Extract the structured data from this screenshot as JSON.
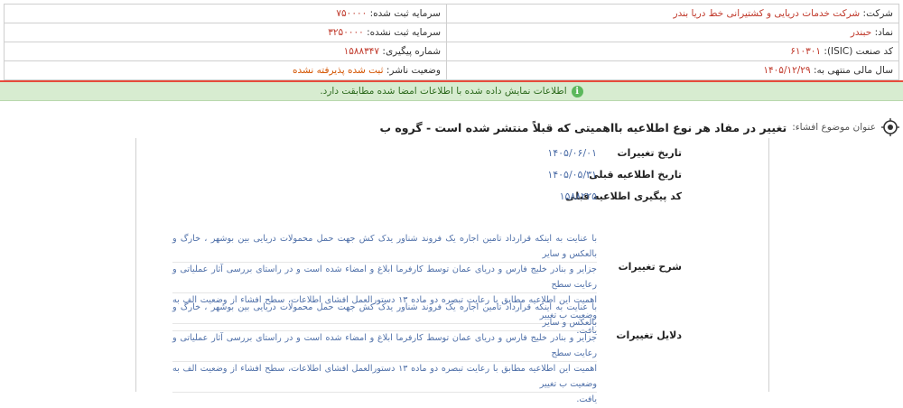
{
  "header": {
    "company_label": "شرکت:",
    "company_value": "شرکت خدمات دریایی و کشتیرانی خط دریا بندر",
    "symbol_label": "نماد:",
    "symbol_value": "حبندر",
    "isic_label": "کد صنعت (ISIC):",
    "isic_value": "۶۱۰۳۰۱",
    "fiscal_label": "سال مالی منتهی به:",
    "fiscal_value": "۱۴۰۵/۱۲/۲۹",
    "capital_registered_label": "سرمایه ثبت شده:",
    "capital_registered_value": "۷۵۰۰۰۰",
    "capital_unregistered_label": "سرمایه ثبت نشده:",
    "capital_unregistered_value": "۳۲۵۰۰۰۰",
    "tracking_label": "شماره پیگیری:",
    "tracking_value": "۱۵۸۸۳۴۷",
    "publisher_status_label": "وضعیت ناشر:",
    "publisher_status_value": "ثبت شده پذیرفته نشده"
  },
  "notice": {
    "text": "اطلاعات نمایش داده شده با اطلاعات امضا شده مطابقت دارد.",
    "icon": "info-icon"
  },
  "subject": {
    "label": "عنوان موضوع افشاء:",
    "title": "تغییر در مفاد هر نوع اطلاعیه بااهمیتی که قبلاً منتشر شده است - گروه ب",
    "icon": "target-icon"
  },
  "details": {
    "change_date_label": "تاریخ تغییرات",
    "change_date_value": "۱۴۰۵/۰۶/۰۱",
    "prev_notice_date_label": "تاریخ اطلاعیه قبلی",
    "prev_notice_date_value": "۱۴۰۵/۰۵/۳۱",
    "prev_tracking_label": "کد پیگیری اطلاعیه قبلی",
    "prev_tracking_value": "۱۵۸۸۲۲۵",
    "description_label": "شرح تغییرات",
    "description_lines": [
      "با عنایت به اینکه قرارداد تامین اجاره یک فروند شناور یدک کش جهت حمل محمولات دریایی بین بوشهر ، خارگ و بالعکس و سایر",
      "جزایر و بنادر خلیج فارس و دریای عمان توسط کارفرما ابلاغ و امضاء شده است و در راستای بررسی آثار عملیاتی و رعایت سطح",
      "اهمیت این اطلاعیه مطابق با رعایت تبصره دو ماده ۱۳ دستورالعمل افشای اطلاعات، سطح افشاء از وضعیت الف به وضعیت ب تغییر",
      "یافت."
    ],
    "reasons_label": "دلایل تغییرات",
    "reasons_lines": [
      "با عنایت به اینکه قرارداد تامین اجاره یک فروند شناور یدک کش جهت حمل محمولات دریایی بین بوشهر ، خارگ و بالعکس و سایر",
      "جزایر و بنادر خلیج فارس و دریای عمان توسط کارفرما ابلاغ و امضاء شده است و در راستای بررسی آثار عملیاتی و رعایت سطح",
      "اهمیت این اطلاعیه مطابق با رعایت تبصره دو ماده ۱۳ دستورالعمل افشای اطلاعات، سطح افشاء از وضعیت الف به وضعیت ب تغییر",
      "یافت."
    ]
  },
  "colors": {
    "accent_red": "#c0392b",
    "link_blue": "#4e6fa8",
    "notice_bg": "#d7ecd0",
    "divider_red": "#e74c3c"
  }
}
